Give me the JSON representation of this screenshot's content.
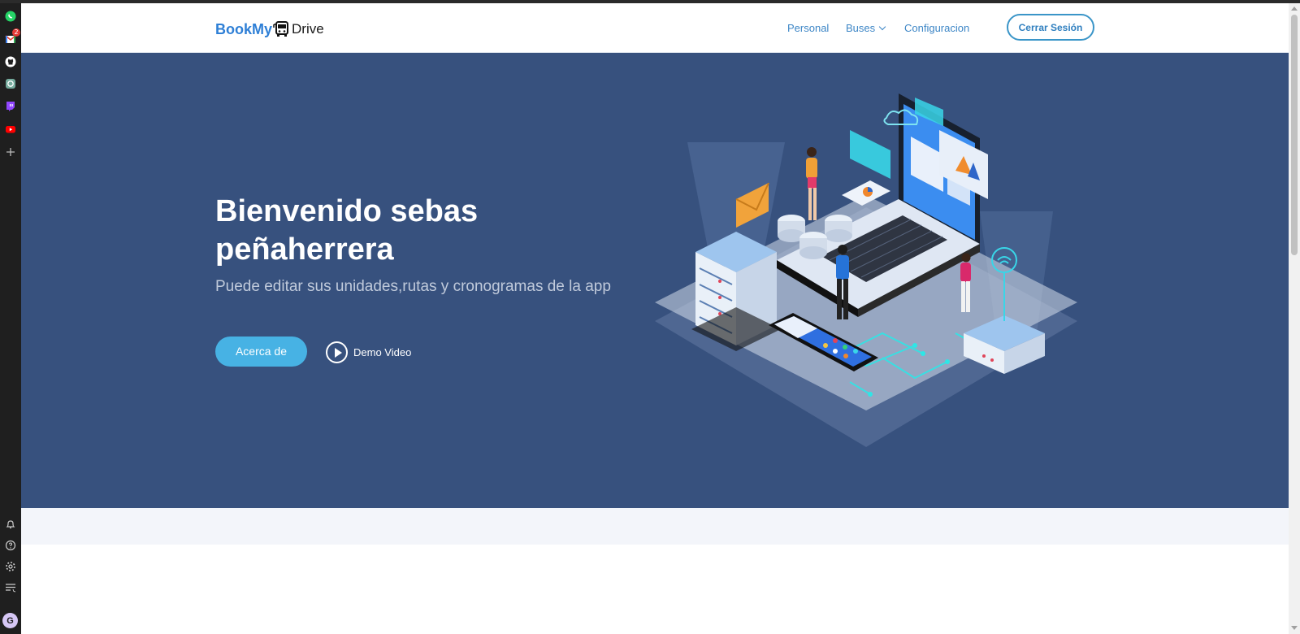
{
  "browser_sidebar": {
    "icons": [
      "whatsapp-icon",
      "gmail-icon",
      "github-icon",
      "chatgpt-icon",
      "twitch-icon",
      "youtube-icon",
      "plus-icon",
      "bell-icon",
      "help-icon",
      "settings-icon",
      "reading-list-icon"
    ],
    "gmail_badge": "2",
    "avatar_initial": "G"
  },
  "header": {
    "logo_brand": "BookMy",
    "logo_suffix": "Drive",
    "nav": {
      "personal": "Personal",
      "buses": "Buses",
      "config": "Configuracion"
    },
    "logout_label": "Cerrar Sesión"
  },
  "hero": {
    "title": "Bienvenido sebas peñaherrera",
    "subtitle": "Puede editar sus unidades,rutas y cronogramas de la app",
    "about_button": "Acerca de",
    "demo_label": "Demo Video"
  },
  "colors": {
    "hero_bg": "#37517e",
    "accent": "#47b2e4",
    "nav_link": "#3d86c6",
    "brand_blue": "#2e7fd6"
  }
}
